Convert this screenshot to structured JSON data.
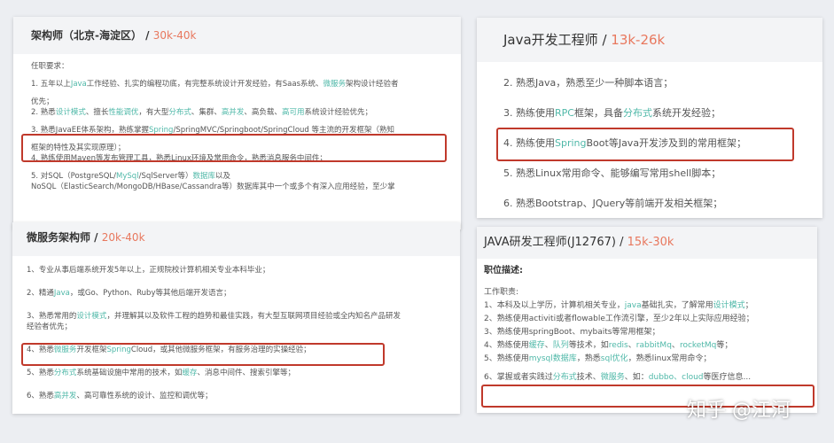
{
  "cards": [
    {
      "title": "架构师（北京-海淀区） / ",
      "salary": "30k-40k",
      "intro": "任职要求：",
      "lines": [
        [
          {
            "t": "1. 五年以上"
          },
          {
            "t": "Java",
            "hl": 1
          },
          {
            "t": "工作经验、扎实的编程功底，有完整系统设计开发经验，有Saas系统、"
          },
          {
            "t": "微服务",
            "hl": 1
          },
          {
            "t": "架构设计经验者"
          }
        ],
        [
          {
            "t": "优先；"
          }
        ],
        [
          {
            "t": "2. 熟悉"
          },
          {
            "t": "设计模式",
            "hl": 1
          },
          {
            "t": "、擅长"
          },
          {
            "t": "性能调优",
            "hl": 1
          },
          {
            "t": "，有大型"
          },
          {
            "t": "分布式",
            "hl": 1
          },
          {
            "t": "、集群、"
          },
          {
            "t": "高并发",
            "hl": 1
          },
          {
            "t": "、高负载、"
          },
          {
            "t": "高可用",
            "hl": 1
          },
          {
            "t": "系统设计经验优先；"
          }
        ],
        [
          {
            "t": "3. 熟悉JavaEE体系架构，熟练掌握"
          },
          {
            "t": "Spring",
            "hl": 1
          },
          {
            "t": "/SpringMVC/Springboot/SpringCloud 等主流的开发框架（熟知"
          }
        ],
        [
          {
            "t": "框架的特性及其实现原理）；"
          }
        ],
        [
          {
            "t": "4. 熟练使用Maven等发布管理工具，熟悉Linux环境及常用命令，熟悉消息服务中间件；"
          }
        ],
        [
          {
            "t": "5. 对SQL（PostgreSQL/"
          },
          {
            "t": "MySql",
            "hl": 1
          },
          {
            "t": "/SqlServer等）"
          },
          {
            "t": "数据库",
            "hl": 1
          },
          {
            "t": "以及"
          }
        ],
        [
          {
            "t": "NoSQL（ElasticSearch/MongoDB/HBase/Cassandra等）数据库其中一个或多个有深入应用经验，至少掌"
          }
        ]
      ]
    },
    {
      "title": "微服务架构师 / ",
      "salary": "20k-40k",
      "lines": [
        [
          {
            "t": "1、专业从事后端系统开发5年以上，正规院校计算机相关专业本科毕业；"
          }
        ],
        [
          {
            "t": "2、精通"
          },
          {
            "t": "Java",
            "hl": 1
          },
          {
            "t": "，或Go、Python、Ruby等其他后端开发语言；"
          }
        ],
        [
          {
            "t": "3、熟悉常用的"
          },
          {
            "t": "设计模式",
            "hl": 1
          },
          {
            "t": "，并理解其以及软件工程的趋势和最佳实践，有大型互联网项目经验或全内知名产品研发"
          }
        ],
        [
          {
            "t": "经验者优先；"
          }
        ],
        [
          {
            "t": "4、熟悉"
          },
          {
            "t": "微服务",
            "hl": 1
          },
          {
            "t": "开发框架"
          },
          {
            "t": "Spring",
            "hl": 1
          },
          {
            "t": "Cloud，或其他微服务框架，有服务治理的实操经验；"
          }
        ],
        [
          {
            "t": "5、熟悉"
          },
          {
            "t": "分布式",
            "hl": 1
          },
          {
            "t": "系统基础设施中常用的技术，如"
          },
          {
            "t": "缓存",
            "hl": 1
          },
          {
            "t": "、消息中间件、搜索引擎等；"
          }
        ],
        [
          {
            "t": "6、熟悉"
          },
          {
            "t": "高并发",
            "hl": 1
          },
          {
            "t": "、高可靠性系统的设计、监控和调优等；"
          }
        ]
      ]
    },
    {
      "title": "Java开发工程师 / ",
      "salary": "13k-26k",
      "lines": [
        [
          {
            "t": "2. 熟悉Java，熟悉至少一种脚本语言；"
          }
        ],
        [
          {
            "t": "3. 熟练使用"
          },
          {
            "t": "RPC",
            "hl": 1
          },
          {
            "t": "框架，具备"
          },
          {
            "t": "分布式",
            "hl": 1
          },
          {
            "t": "系统开发经验；"
          }
        ],
        [
          {
            "t": "4. 熟练使用"
          },
          {
            "t": "Spring",
            "hl": 1
          },
          {
            "t": "Boot等Java开发涉及到的常用框架；"
          }
        ],
        [
          {
            "t": "5. 熟悉Linux常用命令、能够编写常用shell脚本；"
          }
        ],
        [
          {
            "t": "6. 熟悉Bootstrap、JQuery等前端开发相关框架；"
          }
        ]
      ]
    },
    {
      "title": "JAVA研发工程师(J12767) / ",
      "salary": "15k-30k",
      "subtitle": "职位描述:",
      "intro": "工作职责:",
      "lines": [
        [
          {
            "t": "1、本科及以上学历，计算机相关专业，"
          },
          {
            "t": "java",
            "hl": 1
          },
          {
            "t": "基础扎实，了解常用"
          },
          {
            "t": "设计模式",
            "hl": 1
          },
          {
            "t": "；"
          }
        ],
        [
          {
            "t": "2、熟练使用activiti或者flowable工作流引擎，至少2年以上实际应用经验；"
          }
        ],
        [
          {
            "t": "3、熟练使用springBoot、mybaits等常用框架；"
          }
        ],
        [
          {
            "t": "4、熟练使用"
          },
          {
            "t": "缓存",
            "hl": 1
          },
          {
            "t": "、"
          },
          {
            "t": "队列",
            "hl": 1
          },
          {
            "t": "等技术，如"
          },
          {
            "t": "redis",
            "hl": 1
          },
          {
            "t": "、"
          },
          {
            "t": "rabbitMq",
            "hl": 1
          },
          {
            "t": "、"
          },
          {
            "t": "rocketMq",
            "hl": 1
          },
          {
            "t": "等；"
          }
        ],
        [
          {
            "t": "5、熟练使用"
          },
          {
            "t": "mysql数据库",
            "hl": 1
          },
          {
            "t": "，熟悉"
          },
          {
            "t": "sql优化",
            "hl": 1
          },
          {
            "t": "，熟悉linux常用命令；"
          }
        ],
        [
          {
            "t": "6、掌握或者实践过"
          },
          {
            "t": "分布式",
            "hl": 1
          },
          {
            "t": "技术、"
          },
          {
            "t": "微服务",
            "hl": 1
          },
          {
            "t": "、如："
          },
          {
            "t": "dubbo、cloud",
            "hl": 1
          },
          {
            "t": "等医疗信息..."
          }
        ]
      ]
    }
  ],
  "watermark": "知乎 @江河",
  "colors": {
    "salary": "#e8785e",
    "highlight": "#4fb8a8",
    "box": "#c0392b"
  }
}
